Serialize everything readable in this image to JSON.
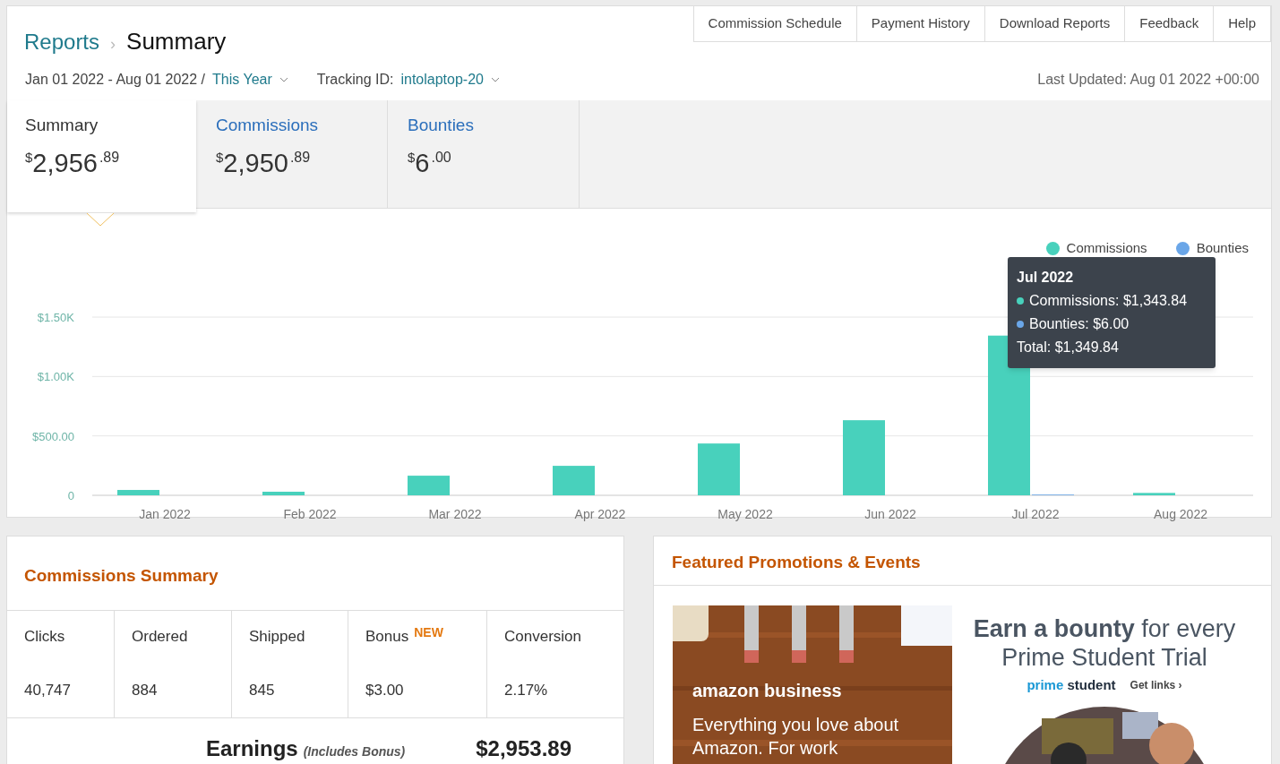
{
  "breadcrumb": {
    "parent": "Reports",
    "separator": "›",
    "current": "Summary"
  },
  "top_links": [
    {
      "label": "Commission Schedule"
    },
    {
      "label": "Payment History"
    },
    {
      "label": "Download Reports"
    },
    {
      "label": "Feedback"
    },
    {
      "label": "Help"
    }
  ],
  "filters": {
    "date_range": "Jan 01 2022 - Aug 01 2022 /",
    "period": "This Year",
    "tracking_label": "Tracking ID:",
    "tracking_id": "intolaptop-20"
  },
  "last_updated": "Last Updated: Aug 01 2022 +00:00",
  "summary_tabs": [
    {
      "label": "Summary",
      "currency": "$",
      "whole": "2,956",
      "cents": ".89",
      "selected": true
    },
    {
      "label": "Commissions",
      "currency": "$",
      "whole": "2,950",
      "cents": ".89",
      "selected": false
    },
    {
      "label": "Bounties",
      "currency": "$",
      "whole": "6",
      "cents": ".00",
      "selected": false
    }
  ],
  "chart": {
    "chart_data": {
      "type": "bar",
      "categories": [
        "Jan 2022",
        "Feb 2022",
        "Mar 2022",
        "Apr 2022",
        "May 2022",
        "Jun 2022",
        "Jul 2022",
        "Aug 2022"
      ],
      "series": [
        {
          "name": "Commissions",
          "color": "#48d1bc",
          "values": [
            45,
            30,
            165,
            248,
            436,
            632,
            1344,
            20
          ]
        },
        {
          "name": "Bounties",
          "color": "#6aa6e8",
          "values": [
            0,
            0,
            0,
            0,
            0,
            0,
            6,
            0
          ]
        }
      ],
      "ylim": [
        0,
        1500
      ],
      "yticks": [
        {
          "value": 0,
          "label": "0"
        },
        {
          "value": 500,
          "label": "$500.00"
        },
        {
          "value": 1000,
          "label": "$1.00K"
        },
        {
          "value": 1500,
          "label": "$1.50K"
        }
      ]
    },
    "tooltip": {
      "title": "Jul 2022",
      "lines": [
        {
          "text": "Commissions: $1,343.84",
          "color": "#48d1bc"
        },
        {
          "text": "Bounties: $6.00",
          "color": "#6aa6e8"
        }
      ],
      "total": "Total: $1,349.84"
    }
  },
  "commissions_summary": {
    "title": "Commissions Summary",
    "columns": [
      {
        "label": "Clicks",
        "value": "40,747"
      },
      {
        "label": "Ordered",
        "value": "884"
      },
      {
        "label": "Shipped",
        "value": "845"
      },
      {
        "label": "Bonus",
        "badge": "NEW",
        "value": "$3.00"
      },
      {
        "label": "Conversion",
        "value": "2.17%"
      }
    ],
    "earnings_label": "Earnings",
    "earnings_note": "(Includes Bonus)",
    "earnings_value": "$2,953.89"
  },
  "promotions": {
    "title": "Featured Promotions & Events",
    "banner_left": {
      "brand": "amazon business",
      "tagline": "Everything you love about Amazon. For work"
    },
    "banner_right": {
      "headline": "**Earn a bounty** for every Prime Student Trial",
      "brand_first": "prime",
      "brand_second": "student",
      "link": "Get links ›"
    }
  }
}
